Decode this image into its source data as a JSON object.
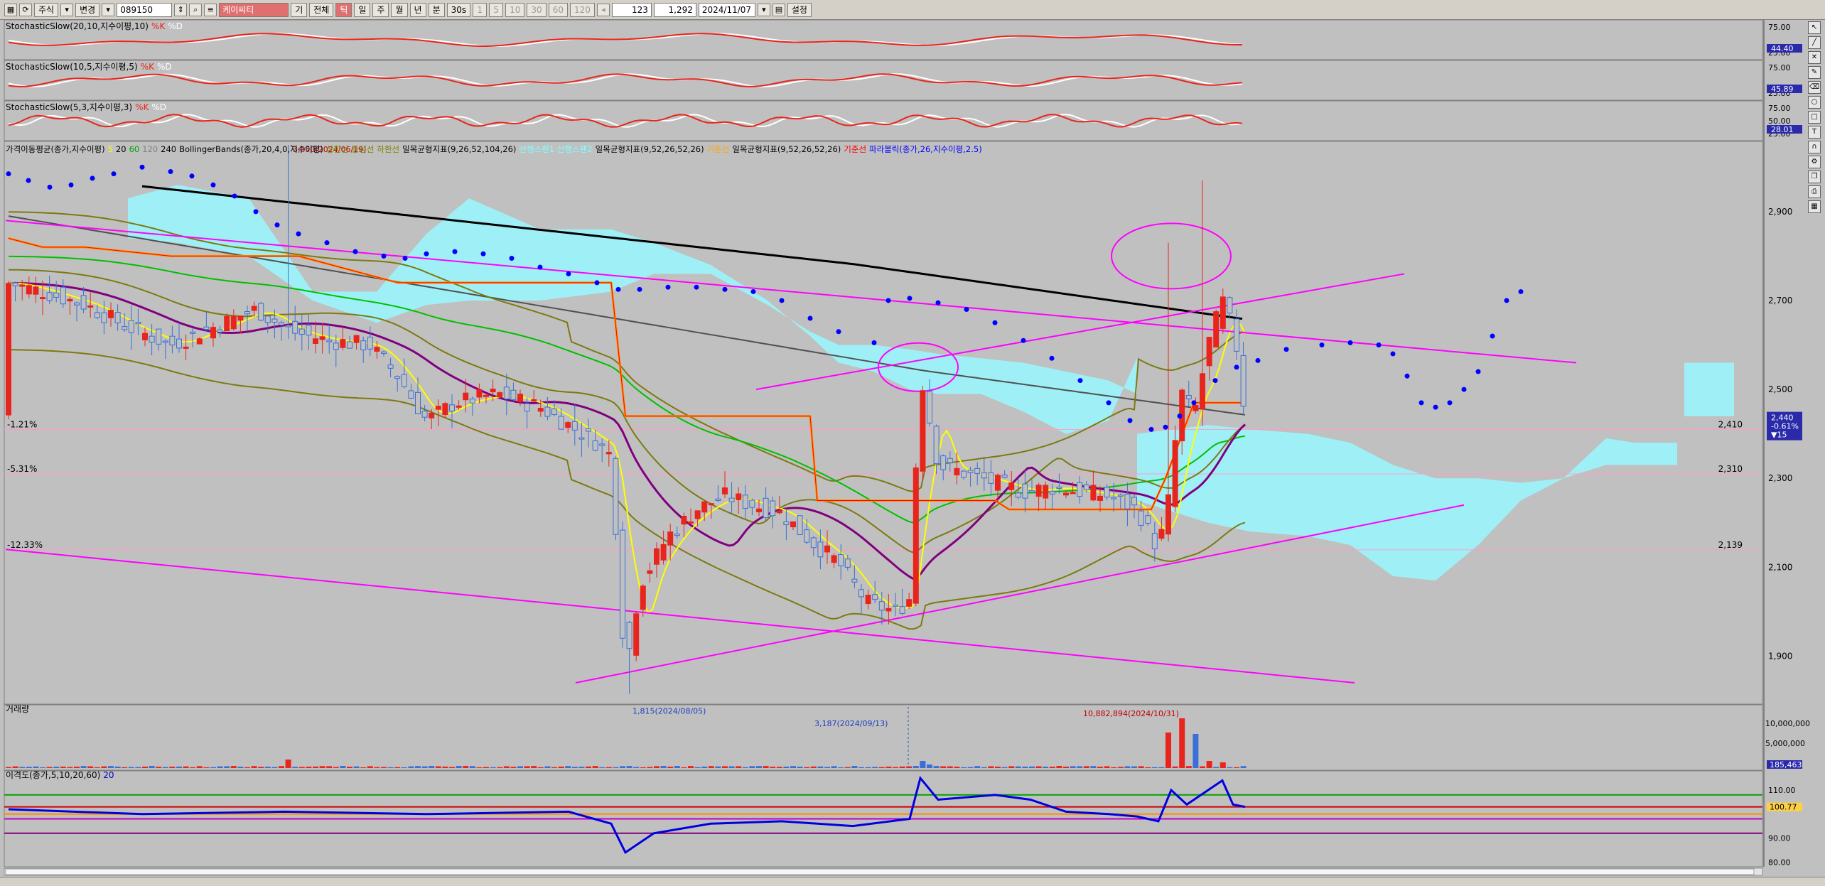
{
  "toolbar": {
    "type_label": "주식",
    "change_label": "변경",
    "code_value": "089150",
    "name_value": "케이씨티",
    "period_buttons": [
      "기",
      "전체"
    ],
    "interval_buttons": [
      "일",
      "주",
      "월",
      "년",
      "분",
      "30s",
      "틱"
    ],
    "count_value": "123",
    "ratio_value": "1,292",
    "date_value": "2024/11/07",
    "settings_label": "설정",
    "minute_options": [
      "1",
      "5",
      "10",
      "30",
      "60",
      "120"
    ]
  },
  "panels": {
    "stoch1": {
      "title": "StochasticSlow(20,10,지수이평,10)",
      "k_label": "%K",
      "d_label": "%D",
      "ticks": [
        "75.00",
        "25.00"
      ],
      "last_value": "44.40"
    },
    "stoch2": {
      "title": "StochasticSlow(10,5,지수이평,5)",
      "k_label": "%K",
      "d_label": "%D",
      "ticks": [
        "75.00",
        "25.00"
      ],
      "last_value": "45.89"
    },
    "stoch3": {
      "title": "StochasticSlow(5,3,지수이평,3)",
      "k_label": "%K",
      "d_label": "%D",
      "ticks": [
        "75.00",
        "50.00",
        "25.00"
      ],
      "last_value": "28.01"
    },
    "main": {
      "legend": [
        {
          "text": "가격이동평균(종가,지수이평)",
          "color": "#000000"
        },
        {
          "text": "5",
          "color": "#ffff00"
        },
        {
          "text": "20",
          "color": "#000000"
        },
        {
          "text": "60",
          "color": "#00a000"
        },
        {
          "text": "120",
          "color": "#808080"
        },
        {
          "text": "240",
          "color": "#000000"
        },
        {
          "text": "BollingerBands(종가,20,4,0,지수이평)",
          "color": "#000000"
        },
        {
          "text": "상한선",
          "color": "#808000"
        },
        {
          "text": "중심선",
          "color": "#808000"
        },
        {
          "text": "하한선",
          "color": "#808000"
        },
        {
          "text": "일목균형지표(9,26,52,104,26)",
          "color": "#000000"
        },
        {
          "text": "선행스팬1",
          "color": "#80ffff"
        },
        {
          "text": "선행스팬2",
          "color": "#80ffff"
        },
        {
          "text": "일목균형지표(9,52,26,52,26)",
          "color": "#000000"
        },
        {
          "text": "기준선",
          "color": "#ffa500"
        },
        {
          "text": "일목균형지표(9,52,26,52,26)",
          "color": "#000000"
        },
        {
          "text": "기준선",
          "color": "#ff0000"
        },
        {
          "text": "파라볼릭(종가,26,지수이평,2.5)",
          "color": "#0000ff"
        }
      ],
      "price_ticks": [
        "2,900",
        "2,700",
        "2,500",
        "2,300",
        "2,100",
        "1,900"
      ],
      "level_labels": [
        {
          "pct": "-1.21%",
          "price": "2,410"
        },
        {
          "pct": "-5.31%",
          "price": "2,310"
        },
        {
          "pct": "-12.33%",
          "price": "2,139"
        }
      ],
      "high_annotation": "3,050(2024/06/19)",
      "low_annotation": "1,815(2024/08/05)",
      "last_price": "2,440",
      "last_change_pct": "-0.61%",
      "last_change_abs": "▼15"
    },
    "volume": {
      "title": "거래량",
      "annotation_1": "3,187(2024/09/13)",
      "annotation_2": "10,882,894(2024/10/31)",
      "ticks": [
        "10,000,000",
        "5,000,000"
      ],
      "last_value": "185,463"
    },
    "disparity": {
      "title": "이격도(종가,5,10,20,60)",
      "period": "20",
      "ticks": [
        "110.00",
        "90.00",
        "80.00"
      ],
      "last_value": "100.77"
    }
  },
  "colors": {
    "up": "#e8251c",
    "down": "#3b6fd6",
    "cloud": "#9ff0f6",
    "trend": "#ff00ff",
    "psar": "#0000ff",
    "ma5": "#ffff00",
    "ma20": "#800080",
    "ma60": "#00c000",
    "ma120": "#505050",
    "ma240": "#000000",
    "bb": "#7c7a10",
    "kijun": "#ff9000"
  },
  "chart_data": {
    "type": "candlestick",
    "title": "",
    "x_start": "2024/05",
    "x_end": "2024/11/07",
    "ylim": [
      1800,
      3050
    ],
    "key_points": [
      {
        "label": "high",
        "value": 3050,
        "date": "2024/06/19"
      },
      {
        "label": "low",
        "value": 1815,
        "date": "2024/08/05"
      },
      {
        "label": "last",
        "value": 2440,
        "date": "2024/11/07"
      }
    ],
    "volume_points": [
      {
        "label": "3,187",
        "date": "2024/09/13"
      },
      {
        "label": "10,882,894",
        "date": "2024/10/31"
      }
    ],
    "levels": [
      2410,
      2310,
      2139
    ]
  }
}
